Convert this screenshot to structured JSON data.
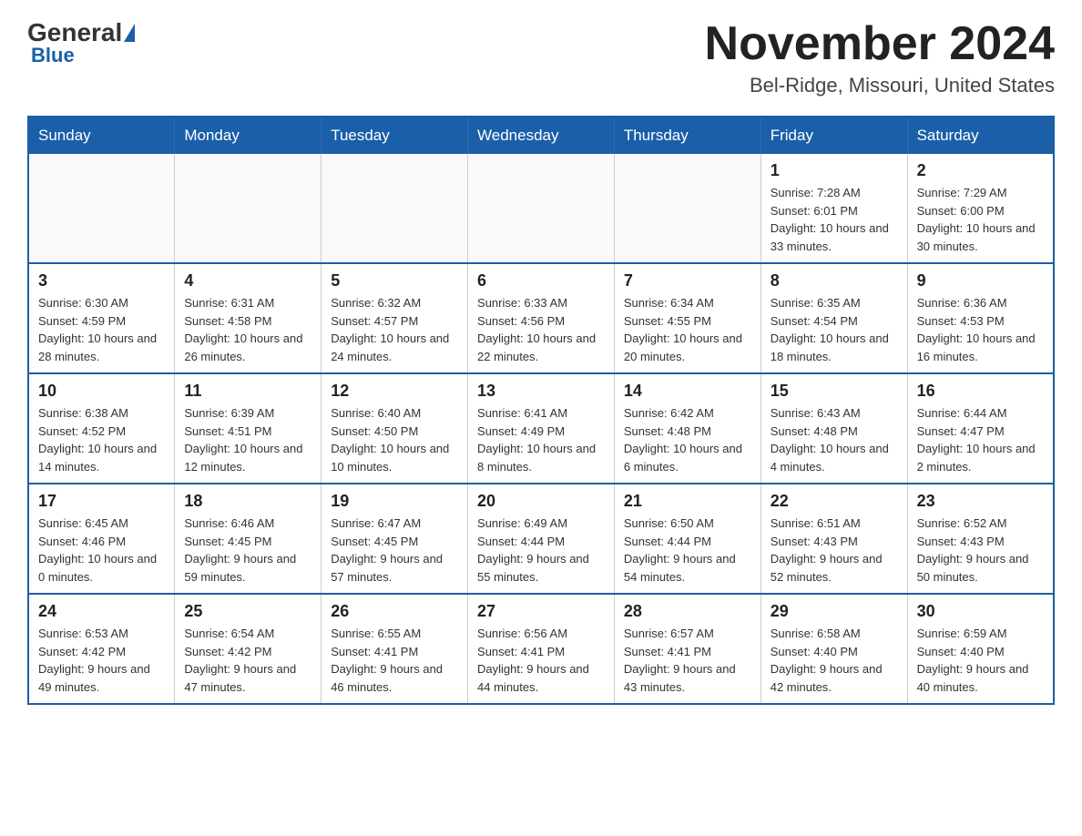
{
  "logo": {
    "general": "General",
    "blue": "Blue",
    "sub": "Blue"
  },
  "title": {
    "month": "November 2024",
    "location": "Bel-Ridge, Missouri, United States"
  },
  "days_of_week": [
    "Sunday",
    "Monday",
    "Tuesday",
    "Wednesday",
    "Thursday",
    "Friday",
    "Saturday"
  ],
  "weeks": [
    [
      {
        "day": "",
        "info": ""
      },
      {
        "day": "",
        "info": ""
      },
      {
        "day": "",
        "info": ""
      },
      {
        "day": "",
        "info": ""
      },
      {
        "day": "",
        "info": ""
      },
      {
        "day": "1",
        "info": "Sunrise: 7:28 AM\nSunset: 6:01 PM\nDaylight: 10 hours and 33 minutes."
      },
      {
        "day": "2",
        "info": "Sunrise: 7:29 AM\nSunset: 6:00 PM\nDaylight: 10 hours and 30 minutes."
      }
    ],
    [
      {
        "day": "3",
        "info": "Sunrise: 6:30 AM\nSunset: 4:59 PM\nDaylight: 10 hours and 28 minutes."
      },
      {
        "day": "4",
        "info": "Sunrise: 6:31 AM\nSunset: 4:58 PM\nDaylight: 10 hours and 26 minutes."
      },
      {
        "day": "5",
        "info": "Sunrise: 6:32 AM\nSunset: 4:57 PM\nDaylight: 10 hours and 24 minutes."
      },
      {
        "day": "6",
        "info": "Sunrise: 6:33 AM\nSunset: 4:56 PM\nDaylight: 10 hours and 22 minutes."
      },
      {
        "day": "7",
        "info": "Sunrise: 6:34 AM\nSunset: 4:55 PM\nDaylight: 10 hours and 20 minutes."
      },
      {
        "day": "8",
        "info": "Sunrise: 6:35 AM\nSunset: 4:54 PM\nDaylight: 10 hours and 18 minutes."
      },
      {
        "day": "9",
        "info": "Sunrise: 6:36 AM\nSunset: 4:53 PM\nDaylight: 10 hours and 16 minutes."
      }
    ],
    [
      {
        "day": "10",
        "info": "Sunrise: 6:38 AM\nSunset: 4:52 PM\nDaylight: 10 hours and 14 minutes."
      },
      {
        "day": "11",
        "info": "Sunrise: 6:39 AM\nSunset: 4:51 PM\nDaylight: 10 hours and 12 minutes."
      },
      {
        "day": "12",
        "info": "Sunrise: 6:40 AM\nSunset: 4:50 PM\nDaylight: 10 hours and 10 minutes."
      },
      {
        "day": "13",
        "info": "Sunrise: 6:41 AM\nSunset: 4:49 PM\nDaylight: 10 hours and 8 minutes."
      },
      {
        "day": "14",
        "info": "Sunrise: 6:42 AM\nSunset: 4:48 PM\nDaylight: 10 hours and 6 minutes."
      },
      {
        "day": "15",
        "info": "Sunrise: 6:43 AM\nSunset: 4:48 PM\nDaylight: 10 hours and 4 minutes."
      },
      {
        "day": "16",
        "info": "Sunrise: 6:44 AM\nSunset: 4:47 PM\nDaylight: 10 hours and 2 minutes."
      }
    ],
    [
      {
        "day": "17",
        "info": "Sunrise: 6:45 AM\nSunset: 4:46 PM\nDaylight: 10 hours and 0 minutes."
      },
      {
        "day": "18",
        "info": "Sunrise: 6:46 AM\nSunset: 4:45 PM\nDaylight: 9 hours and 59 minutes."
      },
      {
        "day": "19",
        "info": "Sunrise: 6:47 AM\nSunset: 4:45 PM\nDaylight: 9 hours and 57 minutes."
      },
      {
        "day": "20",
        "info": "Sunrise: 6:49 AM\nSunset: 4:44 PM\nDaylight: 9 hours and 55 minutes."
      },
      {
        "day": "21",
        "info": "Sunrise: 6:50 AM\nSunset: 4:44 PM\nDaylight: 9 hours and 54 minutes."
      },
      {
        "day": "22",
        "info": "Sunrise: 6:51 AM\nSunset: 4:43 PM\nDaylight: 9 hours and 52 minutes."
      },
      {
        "day": "23",
        "info": "Sunrise: 6:52 AM\nSunset: 4:43 PM\nDaylight: 9 hours and 50 minutes."
      }
    ],
    [
      {
        "day": "24",
        "info": "Sunrise: 6:53 AM\nSunset: 4:42 PM\nDaylight: 9 hours and 49 minutes."
      },
      {
        "day": "25",
        "info": "Sunrise: 6:54 AM\nSunset: 4:42 PM\nDaylight: 9 hours and 47 minutes."
      },
      {
        "day": "26",
        "info": "Sunrise: 6:55 AM\nSunset: 4:41 PM\nDaylight: 9 hours and 46 minutes."
      },
      {
        "day": "27",
        "info": "Sunrise: 6:56 AM\nSunset: 4:41 PM\nDaylight: 9 hours and 44 minutes."
      },
      {
        "day": "28",
        "info": "Sunrise: 6:57 AM\nSunset: 4:41 PM\nDaylight: 9 hours and 43 minutes."
      },
      {
        "day": "29",
        "info": "Sunrise: 6:58 AM\nSunset: 4:40 PM\nDaylight: 9 hours and 42 minutes."
      },
      {
        "day": "30",
        "info": "Sunrise: 6:59 AM\nSunset: 4:40 PM\nDaylight: 9 hours and 40 minutes."
      }
    ]
  ]
}
